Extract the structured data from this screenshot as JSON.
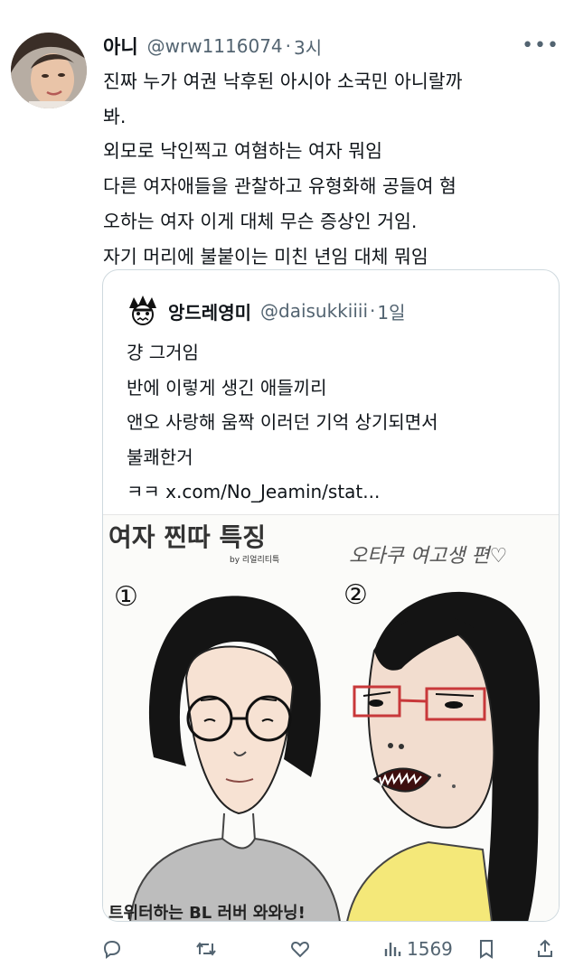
{
  "author": {
    "name": "아니",
    "handle": "@wrw1116074",
    "separator": "·",
    "time": "3시"
  },
  "tweet_lines": [
    "진짜 누가 여권 낙후된 아시아 소국민 아니랄까",
    "봐.",
    "외모로 낙인찍고 여혐하는 여자 뭐임",
    "다른 여자애들을 관찰하고 유형화해 공들여 혐",
    "오하는 여자 이게 대체 무슨 증상인 거임.",
    "자기 머리에 불붙이는 미친 년임 대체 뭐임"
  ],
  "quoted": {
    "name": "앙드레영미",
    "handle": "@daisukkiiii",
    "separator": "·",
    "time": "1일",
    "lines": [
      "걍 그거임",
      "반에 이렇게 생긴 애들끼리",
      "앤오 사랑해 움짝 이러던 기억 상기되면서",
      "불쾌한거",
      "ㅋㅋ x.com/No_Jeamin/stat..."
    ],
    "cartoon": {
      "title": "여자 찐따 특징",
      "byline": "by 리얼리티특",
      "num1": "①",
      "num2": "②",
      "handwritten": "오타쿠 여고생 편♡",
      "bottom_caption": "트위터하는 BL 러버 와와닝!"
    }
  },
  "actions": {
    "reply_icon": "reply-icon",
    "retweet_icon": "retweet-icon",
    "like_icon": "heart-icon",
    "views_icon": "bar-chart-icon",
    "views_count": "1569",
    "bookmark_icon": "bookmark-icon",
    "share_icon": "share-icon"
  },
  "colors": {
    "text": "#0f1419",
    "secondary": "#536471",
    "border": "#cfd9de",
    "glasses_red": "#c8383a",
    "shirt_yellow": "#f4e879"
  }
}
